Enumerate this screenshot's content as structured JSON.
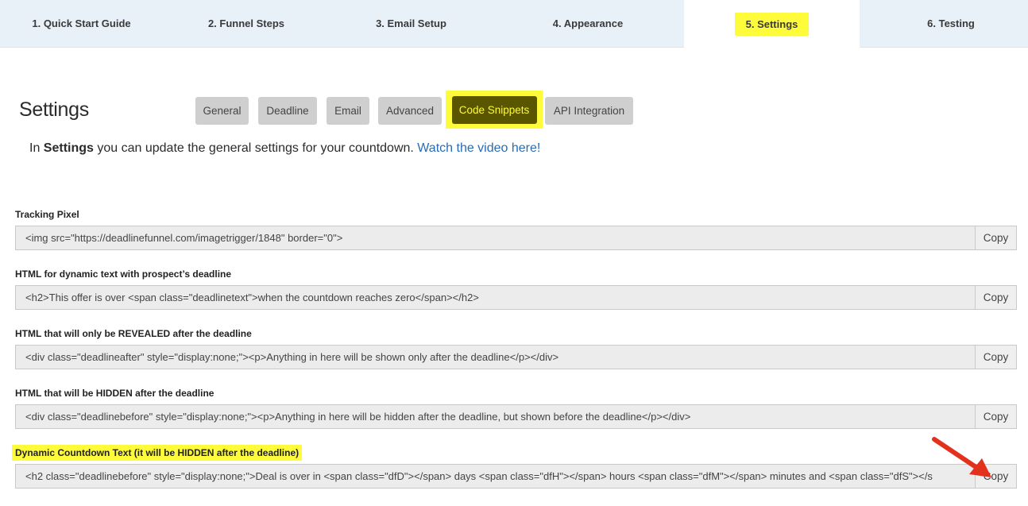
{
  "steps": [
    {
      "label": "1. Quick Start Guide"
    },
    {
      "label": "2. Funnel Steps"
    },
    {
      "label": "3. Email Setup"
    },
    {
      "label": "4. Appearance"
    },
    {
      "label": "5. Settings",
      "active": true
    },
    {
      "label": "6. Testing"
    }
  ],
  "page": {
    "title": "Settings",
    "intro_prefix": "In ",
    "intro_bold": "Settings",
    "intro_middle": " you can update the general settings for your countdown. ",
    "intro_link": "Watch the video here!"
  },
  "subtabs": [
    {
      "label": "General"
    },
    {
      "label": "Deadline"
    },
    {
      "label": "Email"
    },
    {
      "label": "Advanced"
    },
    {
      "label": "Code Snippets",
      "active": true
    },
    {
      "label": "API Integration"
    }
  ],
  "snippets": [
    {
      "label": "Tracking Pixel",
      "value": "<img src=\"https://deadlinefunnel.com/imagetrigger/1848\" border=\"0\">",
      "copy": "Copy"
    },
    {
      "label": "HTML for dynamic text with prospect’s deadline",
      "value": "<h2>This offer is over <span class=\"deadlinetext\">when the countdown reaches zero</span></h2>",
      "copy": "Copy"
    },
    {
      "label": "HTML that will only be REVEALED after the deadline",
      "value": "<div class=\"deadlineafter\" style=\"display:none;\"><p>Anything in here will be shown only after the deadline</p></div>",
      "copy": "Copy"
    },
    {
      "label": "HTML that will be HIDDEN after the deadline",
      "value": "<div class=\"deadlinebefore\" style=\"display:none;\"><p>Anything in here will be hidden after the deadline, but shown before the deadline</p></div>",
      "copy": "Copy"
    },
    {
      "label": "Dynamic Countdown Text (it will be HIDDEN after the deadline)",
      "value": "<h2 class=\"deadlinebefore\" style=\"display:none;\">Deal is over in <span class=\"dfD\"></span> days <span class=\"dfH\"></span> hours <span class=\"dfM\"></span> minutes and <span class=\"dfS\"></s",
      "copy": "Copy"
    }
  ],
  "colors": {
    "highlight": "#fdfb3a",
    "active_tab_bg": "#5a5600",
    "link": "#2a6bb5",
    "arrow": "#e2321e"
  }
}
